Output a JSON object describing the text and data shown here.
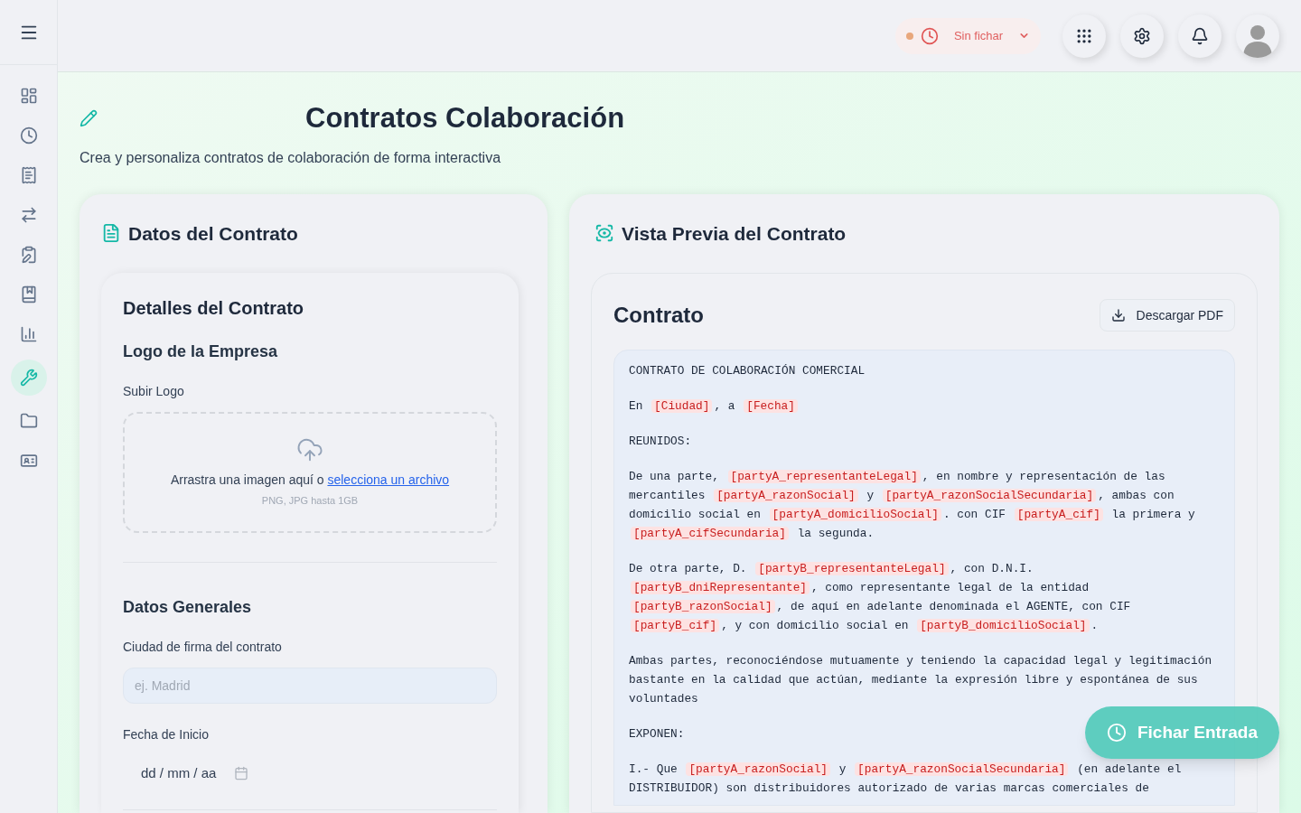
{
  "sidebar": {
    "items": [
      {
        "selected": false
      },
      {
        "selected": false
      },
      {
        "selected": false
      },
      {
        "selected": false
      },
      {
        "selected": false
      },
      {
        "selected": false
      },
      {
        "selected": false
      },
      {
        "selected": true
      },
      {
        "selected": false
      },
      {
        "selected": false
      }
    ]
  },
  "header": {
    "status": {
      "label": "Sin fichar",
      "color": "#e8a77c"
    }
  },
  "page": {
    "title": "Contratos Colaboración",
    "subtitle": "Crea y personaliza contratos de colaboración de forma interactiva"
  },
  "form": {
    "title": "Datos del Contrato",
    "section_title": "Detalles del Contrato",
    "logo": {
      "title": "Logo de la Empresa",
      "label": "Subir Logo",
      "drop_text": "Arrastra una imagen aquí o ",
      "drop_link": "selecciona un archivo",
      "hint": "PNG, JPG hasta 1GB"
    },
    "general": {
      "title": "Datos Generales",
      "city_label": "Ciudad de firma del contrato",
      "city_placeholder": "ej. Madrid",
      "date_label": "Fecha de Inicio",
      "date_placeholder": "dd / mm / aa"
    }
  },
  "preview": {
    "title": "Vista Previa del Contrato",
    "doc_title": "Contrato",
    "download": "Descargar PDF",
    "paragraphs": [
      [
        {
          "kind": "text",
          "text": "CONTRATO DE COLABORACIÓN COMERCIAL"
        }
      ],
      [
        {
          "kind": "text",
          "text": "En "
        },
        {
          "kind": "placeholder",
          "text": "[Ciudad]"
        },
        {
          "kind": "text",
          "text": ", a "
        },
        {
          "kind": "placeholder",
          "text": "[Fecha]"
        }
      ],
      [
        {
          "kind": "text",
          "text": "REUNIDOS:"
        }
      ],
      [
        {
          "kind": "text",
          "text": "De una parte, "
        },
        {
          "kind": "placeholder",
          "text": "[partyA_representanteLegal]"
        },
        {
          "kind": "text",
          "text": ", en nombre y representación de las mercantiles "
        },
        {
          "kind": "placeholder",
          "text": "[partyA_razonSocial]"
        },
        {
          "kind": "text",
          "text": " y "
        },
        {
          "kind": "placeholder",
          "text": "[partyA_razonSocialSecundaria]"
        },
        {
          "kind": "text",
          "text": ", ambas con domicilio social en "
        },
        {
          "kind": "placeholder",
          "text": "[partyA_domicilioSocial]"
        },
        {
          "kind": "text",
          "text": ". con CIF "
        },
        {
          "kind": "placeholder",
          "text": "[partyA_cif]"
        },
        {
          "kind": "text",
          "text": " la primera y "
        },
        {
          "kind": "placeholder",
          "text": "[partyA_cifSecundaria]"
        },
        {
          "kind": "text",
          "text": " la segunda."
        }
      ],
      [
        {
          "kind": "text",
          "text": "De otra parte, D. "
        },
        {
          "kind": "placeholder",
          "text": "[partyB_representanteLegal]"
        },
        {
          "kind": "text",
          "text": ", con D.N.I. "
        },
        {
          "kind": "placeholder",
          "text": "[partyB_dniRepresentante]"
        },
        {
          "kind": "text",
          "text": ", como representante legal de la entidad "
        },
        {
          "kind": "placeholder",
          "text": "[partyB_razonSocial]"
        },
        {
          "kind": "text",
          "text": ", de aquí en adelante denominada el AGENTE, con CIF "
        },
        {
          "kind": "placeholder",
          "text": "[partyB_cif]"
        },
        {
          "kind": "text",
          "text": ", y con domicilio social en "
        },
        {
          "kind": "placeholder",
          "text": "[partyB_domicilioSocial]"
        },
        {
          "kind": "text",
          "text": "."
        }
      ],
      [
        {
          "kind": "text",
          "text": "Ambas partes, reconociéndose mutuamente y teniendo la capacidad legal y legitimación bastante en la calidad que actúan, mediante la expresión libre y espontánea de sus voluntades"
        }
      ],
      [
        {
          "kind": "text",
          "text": "EXPONEN:"
        }
      ],
      [
        {
          "kind": "text",
          "text": "I.- Que "
        },
        {
          "kind": "placeholder",
          "text": "[partyA_razonSocial]"
        },
        {
          "kind": "text",
          "text": " y "
        },
        {
          "kind": "placeholder",
          "text": "[partyA_razonSocialSecundaria]"
        },
        {
          "kind": "text",
          "text": " (en adelante el DISTRIBUIDOR) son distribuidores autorizado de varias marcas comerciales de"
        }
      ]
    ]
  },
  "fab": {
    "label": "Fichar Entrada"
  }
}
